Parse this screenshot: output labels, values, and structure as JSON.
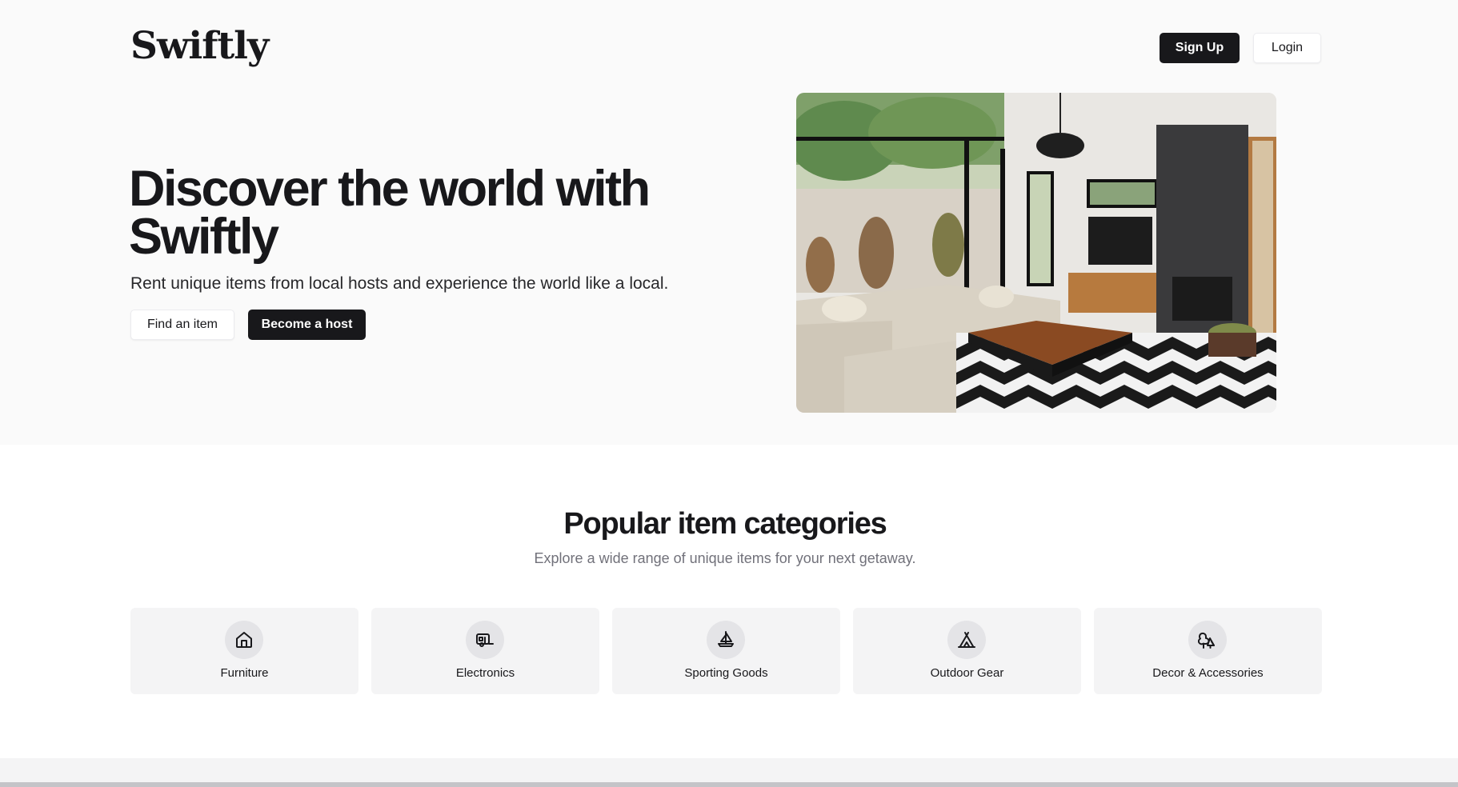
{
  "header": {
    "logo": "Swiftly",
    "signup_label": "Sign Up",
    "login_label": "Login"
  },
  "hero": {
    "title": "Discover the world with Swiftly",
    "subtitle": "Rent unique items from local hosts and experience the world like a local.",
    "find_label": "Find an item",
    "host_label": "Become a host"
  },
  "categories": {
    "title": "Popular item categories",
    "subtitle": "Explore a wide range of unique items for your next getaway.",
    "items": [
      {
        "label": "Furniture",
        "icon": "house-icon"
      },
      {
        "label": "Electronics",
        "icon": "caravan-icon"
      },
      {
        "label": "Sporting Goods",
        "icon": "sailboat-icon"
      },
      {
        "label": "Outdoor Gear",
        "icon": "tent-icon"
      },
      {
        "label": "Decor & Accessories",
        "icon": "trees-icon"
      }
    ]
  },
  "colors": {
    "primary": "#18181b",
    "hero_bg": "#fafafa",
    "card_bg": "#f4f4f5",
    "muted_text": "#71717a"
  }
}
